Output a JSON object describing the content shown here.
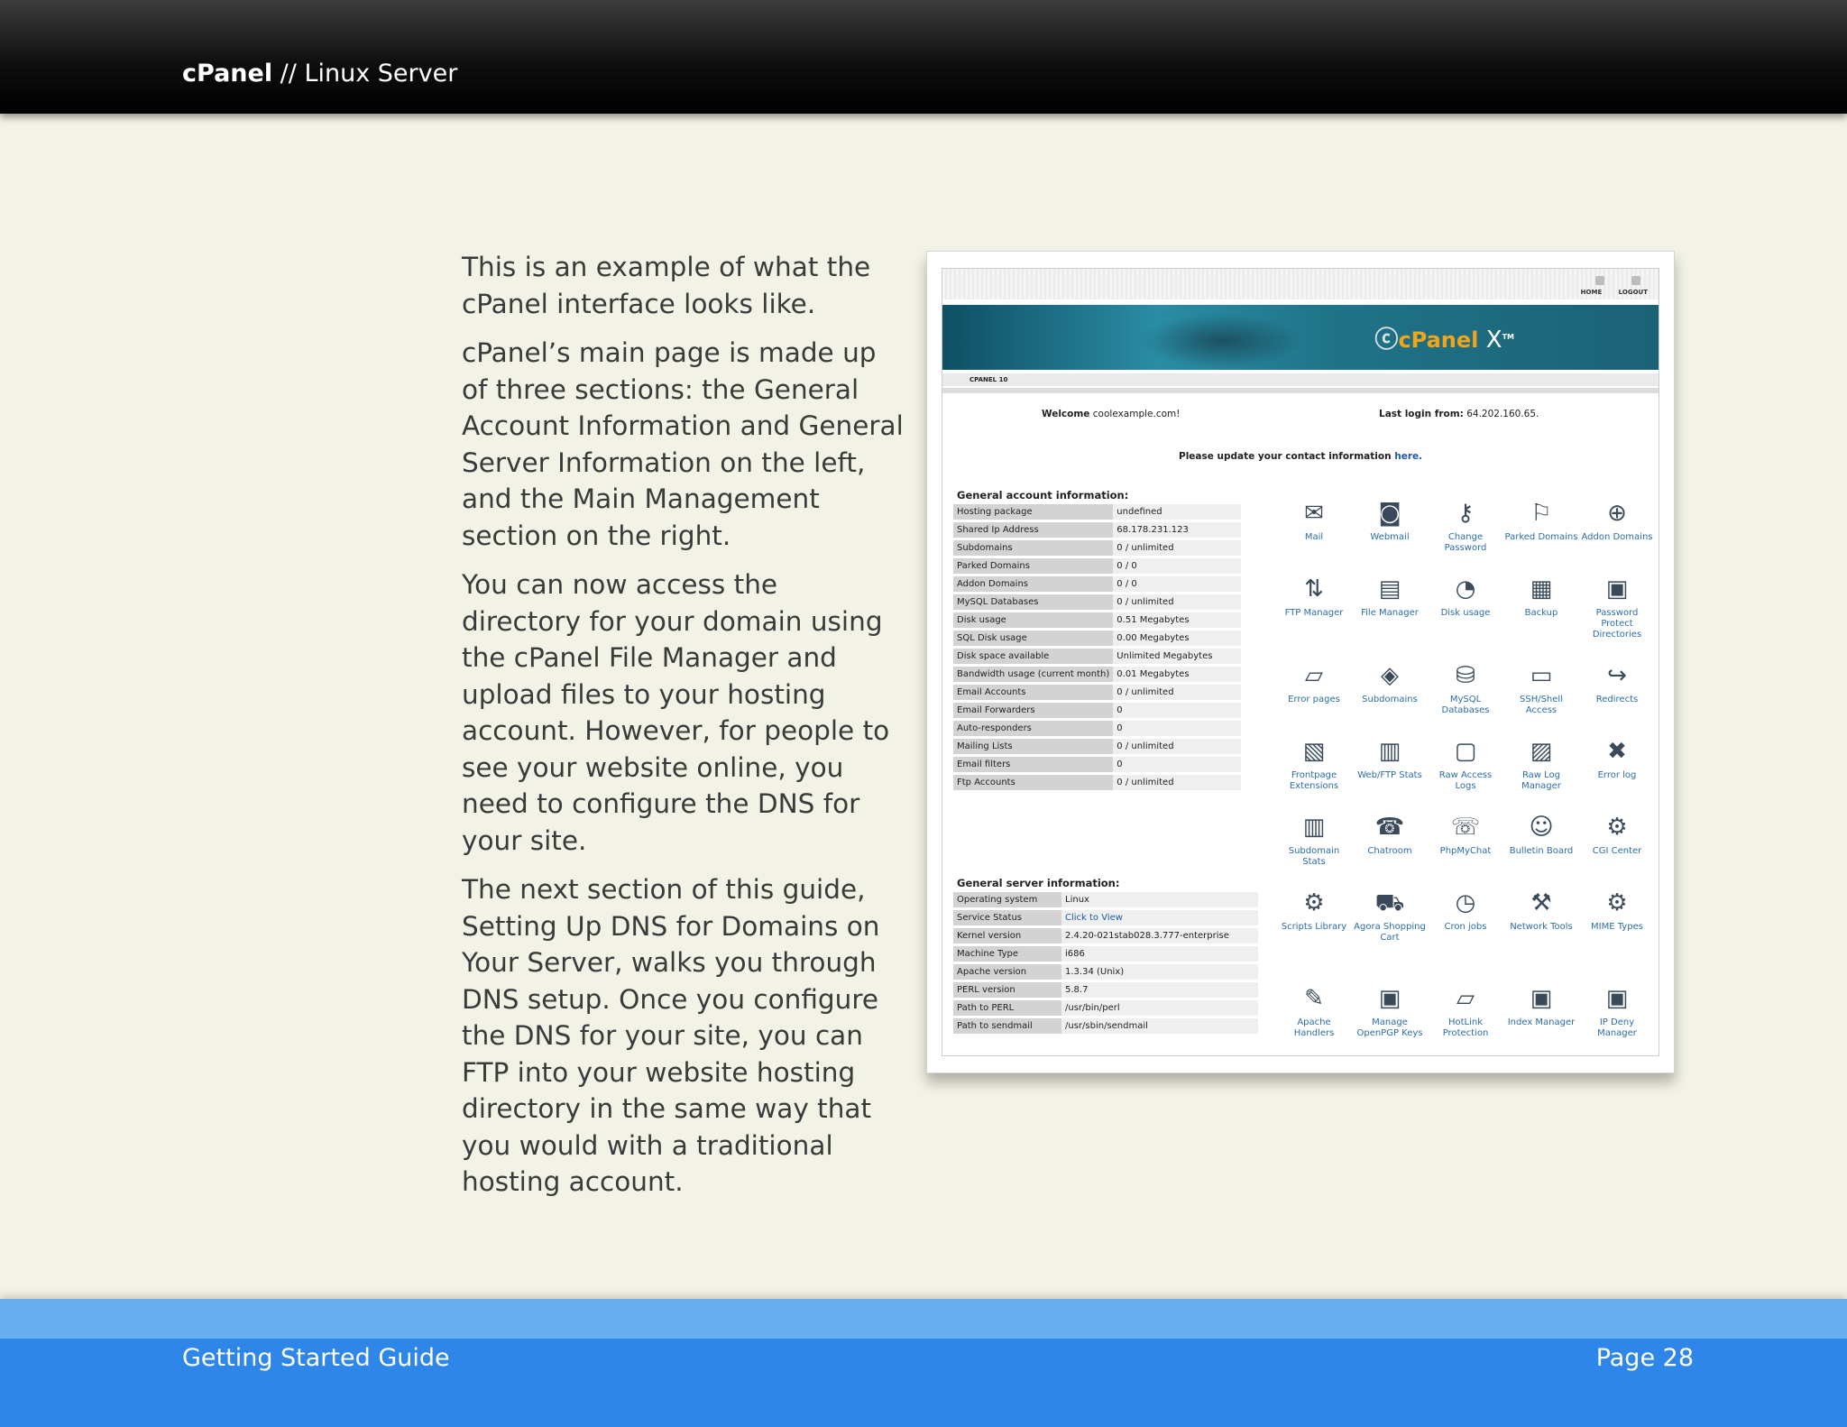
{
  "header": {
    "brand": "cPanel",
    "separator": " // ",
    "subtitle": "Linux Server"
  },
  "body": {
    "paragraphs": [
      "This is an example of what the cPanel interface looks like.",
      "cPanel’s main page is made up of three sections: the General Account Information and General Server Information on the left, and the Main Management section on the right.",
      "You can now access the directory for your domain using the cPanel File Manager and upload files to your hosting account. However, for people to see your website online, you need to configure the DNS for your site.",
      "The next section of this guide, Setting Up DNS for Domains on Your Server, walks you through DNS setup. Once you configure the DNS for your site, you can FTP into your website hosting directory in the same way that you would with a traditional hosting account."
    ]
  },
  "screenshot": {
    "top_links": {
      "home": "HOME",
      "logout": "LOGOUT"
    },
    "logo": {
      "text": "cPanel",
      "x": "X",
      "tm": "TM"
    },
    "crumb": "CPANEL 10",
    "welcome_label": "Welcome",
    "welcome_value": "coolexample.com!",
    "lastlogin_label": "Last login from:",
    "lastlogin_value": "64.202.160.65.",
    "update_text": "Please update your contact information",
    "update_link": "here.",
    "account_title": "General account information:",
    "account_rows": [
      [
        "Hosting package",
        "undefined"
      ],
      [
        "Shared Ip Address",
        "68.178.231.123"
      ],
      [
        "Subdomains",
        "0 / unlimited"
      ],
      [
        "Parked Domains",
        "0 / 0"
      ],
      [
        "Addon Domains",
        "0 / 0"
      ],
      [
        "MySQL Databases",
        "0 / unlimited"
      ],
      [
        "Disk usage",
        "0.51 Megabytes"
      ],
      [
        "SQL Disk usage",
        "0.00 Megabytes"
      ],
      [
        "Disk space available",
        "Unlimited Megabytes"
      ],
      [
        "Bandwidth usage (current month)",
        "0.01 Megabytes"
      ],
      [
        "Email Accounts",
        "0 / unlimited"
      ],
      [
        "Email Forwarders",
        "0"
      ],
      [
        "Auto-responders",
        "0"
      ],
      [
        "Mailing Lists",
        "0 / unlimited"
      ],
      [
        "Email filters",
        "0"
      ],
      [
        "Ftp Accounts",
        "0 / unlimited"
      ]
    ],
    "server_title": "General server information:",
    "server_rows": [
      [
        "Operating system",
        "Linux"
      ],
      [
        "Service Status",
        "Click to View"
      ],
      [
        "Kernel version",
        "2.4.20-021stab028.3.777-enterprise"
      ],
      [
        "Machine Type",
        "i686"
      ],
      [
        "Apache version",
        "1.3.34 (Unix)"
      ],
      [
        "PERL version",
        "5.8.7"
      ],
      [
        "Path to PERL",
        "/usr/bin/perl"
      ],
      [
        "Path to sendmail",
        "/usr/sbin/sendmail"
      ]
    ],
    "icons": [
      {
        "label": "Mail",
        "icon": "mail-icon",
        "glyph": "✉"
      },
      {
        "label": "Webmail",
        "icon": "webmail-icon",
        "glyph": "◙"
      },
      {
        "label": "Change Password",
        "icon": "change-password-icon",
        "glyph": "⚷"
      },
      {
        "label": "Parked Domains",
        "icon": "parked-domains-icon",
        "glyph": "⚐"
      },
      {
        "label": "Addon Domains",
        "icon": "addon-domains-icon",
        "glyph": "⊕"
      },
      {
        "label": "FTP Manager",
        "icon": "ftp-manager-icon",
        "glyph": "⇅"
      },
      {
        "label": "File Manager",
        "icon": "file-manager-icon",
        "glyph": "▤"
      },
      {
        "label": "Disk usage",
        "icon": "disk-usage-icon",
        "glyph": "◔"
      },
      {
        "label": "Backup",
        "icon": "backup-icon",
        "glyph": "▦"
      },
      {
        "label": "Password Protect Directories",
        "icon": "password-protect-icon",
        "glyph": "▣"
      },
      {
        "label": "Error pages",
        "icon": "error-pages-icon",
        "glyph": "▱"
      },
      {
        "label": "Subdomains",
        "icon": "subdomains-icon",
        "glyph": "◈"
      },
      {
        "label": "MySQL Databases",
        "icon": "mysql-icon",
        "glyph": "⛁"
      },
      {
        "label": "SSH/Shell Access",
        "icon": "ssh-shell-icon",
        "glyph": "▭"
      },
      {
        "label": "Redirects",
        "icon": "redirects-icon",
        "glyph": "↪"
      },
      {
        "label": "Frontpage Extensions",
        "icon": "frontpage-icon",
        "glyph": "▧"
      },
      {
        "label": "Web/FTP Stats",
        "icon": "web-ftp-stats-icon",
        "glyph": "▥"
      },
      {
        "label": "Raw Access Logs",
        "icon": "raw-access-logs-icon",
        "glyph": "▢"
      },
      {
        "label": "Raw Log Manager",
        "icon": "raw-log-manager-icon",
        "glyph": "▨"
      },
      {
        "label": "Error log",
        "icon": "error-log-icon",
        "glyph": "✖"
      },
      {
        "label": "Subdomain Stats",
        "icon": "subdomain-stats-icon",
        "glyph": "▥"
      },
      {
        "label": "Chatroom",
        "icon": "chatroom-icon",
        "glyph": "☎"
      },
      {
        "label": "PhpMyChat",
        "icon": "phpmychat-icon",
        "glyph": "☏"
      },
      {
        "label": "Bulletin Board",
        "icon": "bulletin-board-icon",
        "glyph": "☺"
      },
      {
        "label": "CGI Center",
        "icon": "cgi-center-icon",
        "glyph": "⚙"
      },
      {
        "label": "Scripts Library",
        "icon": "scripts-library-icon",
        "glyph": "⚙"
      },
      {
        "label": "Agora Shopping Cart",
        "icon": "shopping-cart-icon",
        "glyph": "⛟"
      },
      {
        "label": "Cron jobs",
        "icon": "cron-jobs-icon",
        "glyph": "◷"
      },
      {
        "label": "Network Tools",
        "icon": "network-tools-icon",
        "glyph": "⚒"
      },
      {
        "label": "MIME Types",
        "icon": "mime-types-icon",
        "glyph": "⚙"
      },
      {
        "label": "Apache Handlers",
        "icon": "apache-handlers-icon",
        "glyph": "✎"
      },
      {
        "label": "Manage OpenPGP Keys",
        "icon": "openpgp-keys-icon",
        "glyph": "▣"
      },
      {
        "label": "HotLink Protection",
        "icon": "hotlink-protection-icon",
        "glyph": "▱"
      },
      {
        "label": "Index Manager",
        "icon": "index-manager-icon",
        "glyph": "▣"
      },
      {
        "label": "IP Deny Manager",
        "icon": "ip-deny-manager-icon",
        "glyph": "▣"
      }
    ]
  },
  "footer": {
    "left": "Getting Started Guide",
    "right": "Page 28"
  }
}
